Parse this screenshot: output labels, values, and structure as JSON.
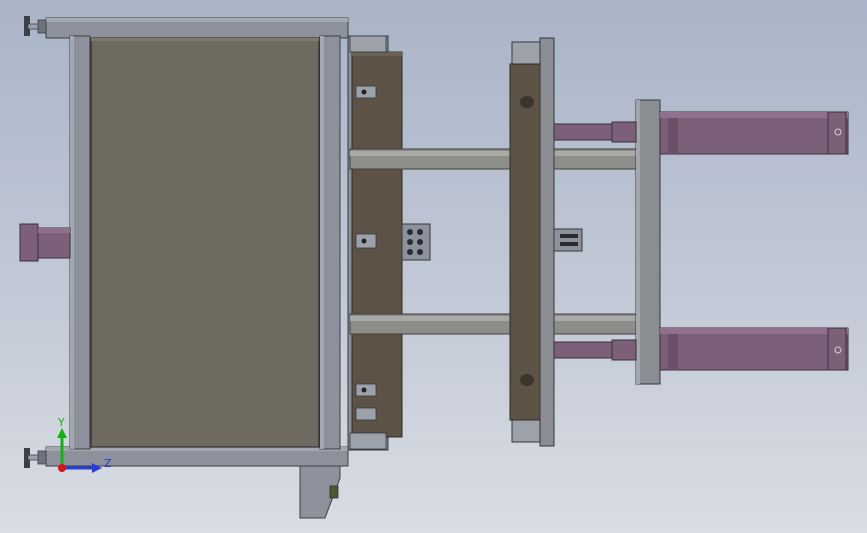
{
  "triad": {
    "y_label": "Y",
    "z_label": "Z",
    "y_color": "#18b018",
    "z_color": "#2a3cd8",
    "origin_color": "#d01818"
  },
  "colors": {
    "background_top": "#a9b4c8",
    "background_bottom": "#d9dde4",
    "frame_steel": "#8c919b",
    "panel": "#6e6a60",
    "mold_body": "#5c5346",
    "rod": "#8d8e8a",
    "cylinder": "#7c5f78",
    "plate": "#8a8d92"
  },
  "parts": [
    "frame",
    "panel",
    "leveling-feet",
    "mold-plate",
    "moving-platen",
    "end-plate",
    "tie-rods",
    "hydraulic-cylinders"
  ]
}
